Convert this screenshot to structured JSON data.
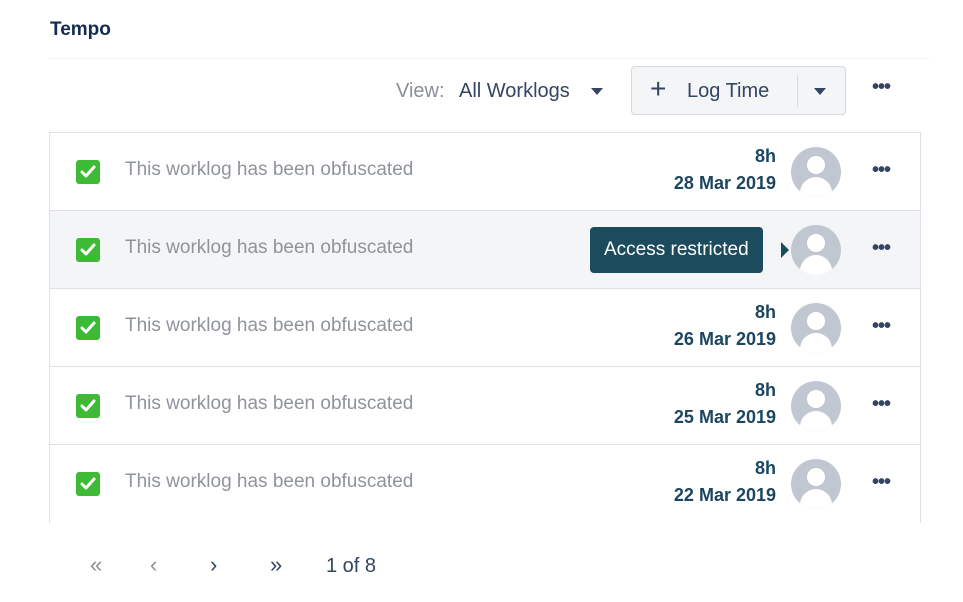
{
  "section": {
    "title": "Tempo"
  },
  "toolbar": {
    "view_label": "View:",
    "view_value": "All Worklogs",
    "log_time_label": "Log Time",
    "more_label": "•••"
  },
  "worklogs": [
    {
      "description": "This worklog has been obfuscated",
      "hours": "8h",
      "date": "28 Mar 2019",
      "more": "•••"
    },
    {
      "description": "This worklog has been obfuscated",
      "hours": "",
      "date": "",
      "more": "•••",
      "tooltip": "Access restricted"
    },
    {
      "description": "This worklog has been obfuscated",
      "hours": "8h",
      "date": "26 Mar 2019",
      "more": "•••"
    },
    {
      "description": "This worklog has been obfuscated",
      "hours": "8h",
      "date": "25 Mar 2019",
      "more": "•••"
    },
    {
      "description": "This worklog has been obfuscated",
      "hours": "8h",
      "date": "22 Mar 2019",
      "more": "•••"
    }
  ],
  "pagination": {
    "first": "«",
    "prev": "‹",
    "next": "›",
    "last": "»",
    "page_info": "1 of 8"
  },
  "colors": {
    "check_green": "#3fba37",
    "date_text": "#1c4560",
    "tooltip_bg": "#1d4b5e",
    "avatar_gray": "#c1c7d0"
  },
  "icons": {
    "checkbox": "check-icon",
    "avatar": "user-avatar-icon",
    "add": "plus-icon",
    "dropdown": "chevron-down-icon",
    "more": "more-horizontal-icon"
  }
}
